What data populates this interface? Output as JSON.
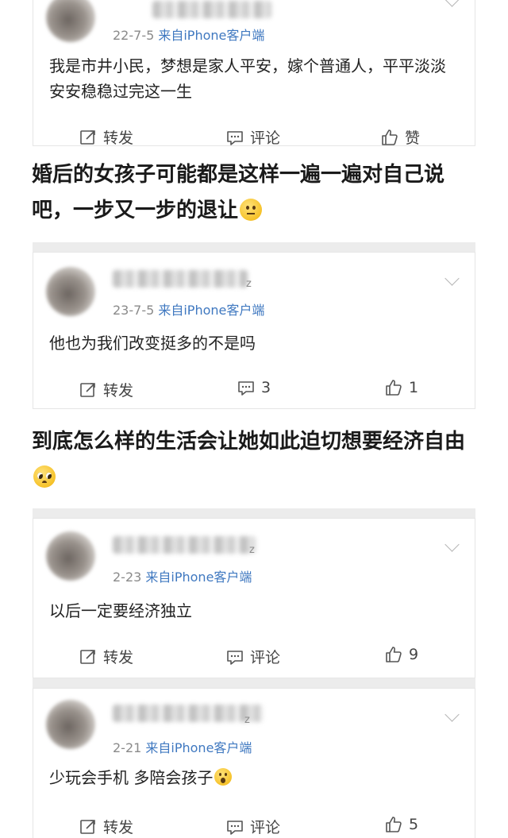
{
  "posts": [
    {
      "id": "post-1",
      "name_suffix": "",
      "meta_date": "22-7-5",
      "meta_source": "来自iPhone客户端",
      "text": "我是市井小民，梦想是家人平安，嫁个普通人，平平淡淡安安稳稳过完这一生",
      "repost_label": "转发",
      "comment_label": "评论",
      "like_label": "赞"
    },
    {
      "id": "post-2",
      "name_suffix": "z",
      "meta_date": "23-7-5",
      "meta_source": "来自iPhone客户端",
      "text": "他也为我们改变挺多的不是吗",
      "repost_label": "转发",
      "comment_label": "3",
      "like_label": "1"
    },
    {
      "id": "post-3",
      "name_suffix": "z",
      "meta_date": "2-23",
      "meta_source": "来自iPhone客户端",
      "text": "以后一定要经济独立",
      "repost_label": "转发",
      "comment_label": "评论",
      "like_label": "9"
    },
    {
      "id": "post-4",
      "name_suffix": "z",
      "meta_date": "2-21",
      "meta_source": "来自iPhone客户端",
      "text": "少玩会手机 多陪会孩子",
      "repost_label": "转发",
      "comment_label": "评论",
      "like_label": "5"
    }
  ],
  "captions": [
    {
      "text": "婚后的女孩子可能都是这样一遍一遍对自己说吧，一步又一步的退让",
      "emoji": "neutral-face-emoji"
    },
    {
      "text": "到底怎么样的生活会让她如此迫切想要经济自由",
      "emoji": "pleading-face-emoji"
    }
  ],
  "post_4_emoji": "screaming-face-emoji",
  "colors": {
    "source_link": "#3f78c0",
    "meta_gray": "#8a8a8a",
    "card_border": "#e6e6e6",
    "band_gray": "#ececec"
  }
}
